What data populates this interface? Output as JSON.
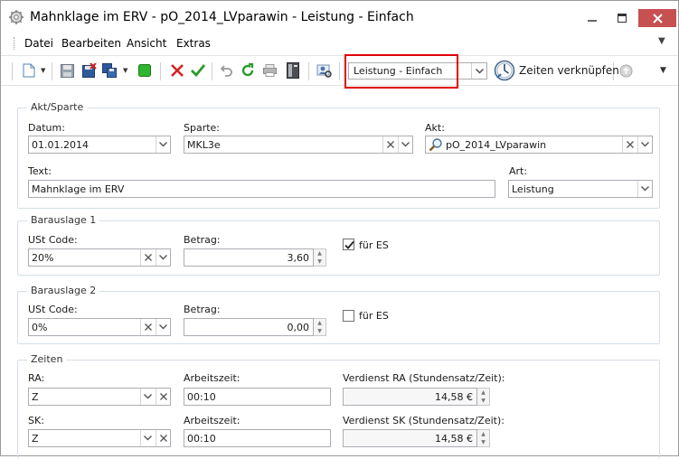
{
  "window": {
    "title": "Mahnklage im ERV - pO_2014_LVparawin - Leistung - Einfach"
  },
  "menu": {
    "items": [
      "Datei",
      "Bearbeiten",
      "Ansicht",
      "Extras"
    ]
  },
  "toolbar": {
    "mode_value": "Leistung - Einfach",
    "link_label": "Zeiten verknüpfen"
  },
  "akt_sparte": {
    "title": "Akt/Sparte",
    "datum_label": "Datum:",
    "datum_value": "01.01.2014",
    "sparte_label": "Sparte:",
    "sparte_value": "MKL3e",
    "akt_label": "Akt:",
    "akt_value": "pO_2014_LVparawin",
    "text_label": "Text:",
    "text_value": "Mahnklage im ERV",
    "art_label": "Art:",
    "art_value": "Leistung"
  },
  "barauslage1": {
    "title": "Barauslage 1",
    "ust_label": "USt Code:",
    "ust_value": "20%",
    "betrag_label": "Betrag:",
    "betrag_value": "3,60",
    "fuer_es_label": "für ES",
    "fuer_es_checked": true
  },
  "barauslage2": {
    "title": "Barauslage 2",
    "ust_label": "USt Code:",
    "ust_value": "0%",
    "betrag_label": "Betrag:",
    "betrag_value": "0,00",
    "fuer_es_label": "für ES",
    "fuer_es_checked": false
  },
  "zeiten": {
    "title": "Zeiten",
    "ra_label": "RA:",
    "ra_value": "Z",
    "ra_arbeitszeit_label": "Arbeitszeit:",
    "ra_arbeitszeit_value": "00:10",
    "ra_verdienst_label": "Verdienst RA (Stundensatz/Zeit):",
    "ra_verdienst_value": "14,58 €",
    "sk_label": "SK:",
    "sk_value": "Z",
    "sk_arbeitszeit_label": "Arbeitszeit:",
    "sk_arbeitszeit_value": "00:10",
    "sk_verdienst_label": "Verdienst SK (Stundensatz/Zeit):",
    "sk_verdienst_value": "14,58 €"
  },
  "colors": {
    "highlight": "#e00000",
    "group_border": "#d5dfe5",
    "close_button": "#c75050"
  }
}
